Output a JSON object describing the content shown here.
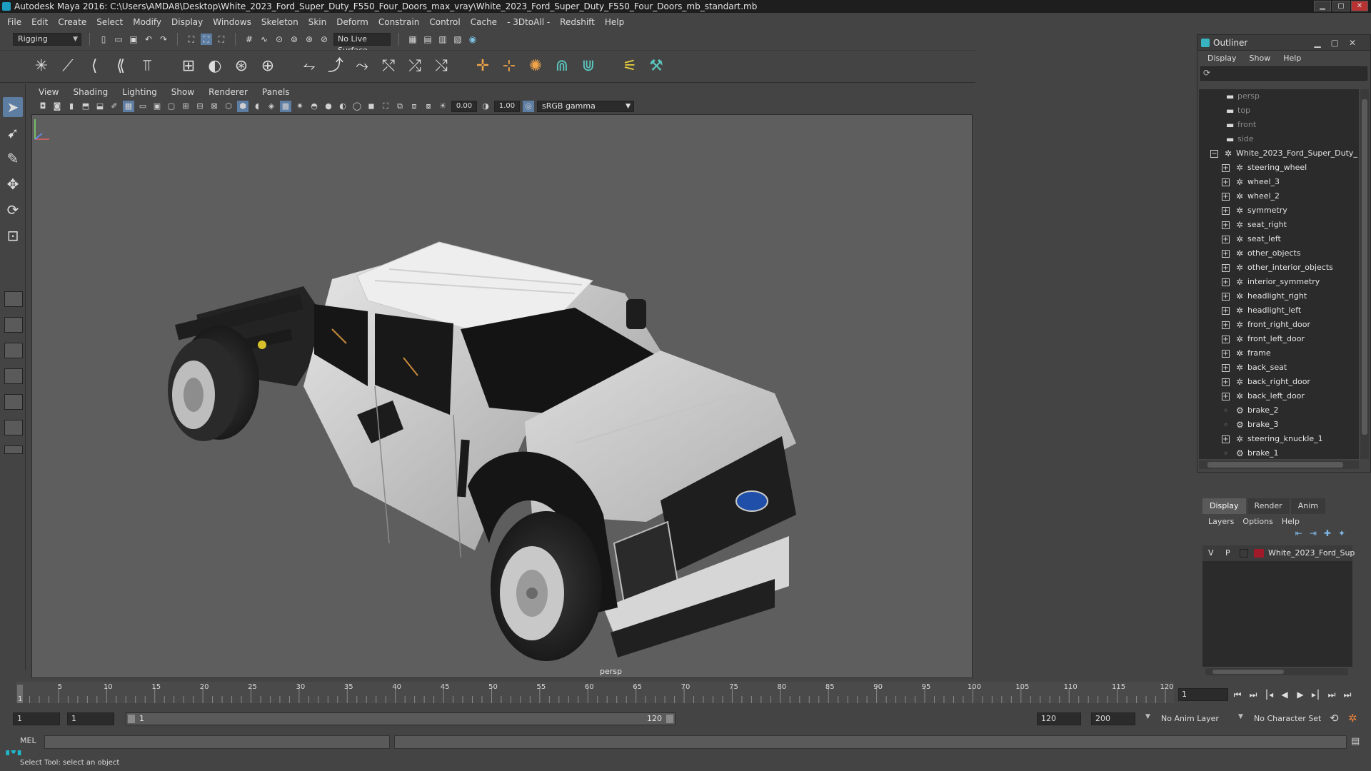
{
  "window": {
    "title": "Autodesk Maya 2016: C:\\Users\\AMDA8\\Desktop\\White_2023_Ford_Super_Duty_F550_Four_Doors_max_vray\\White_2023_Ford_Super_Duty_F550_Four_Doors_mb_standart.mb"
  },
  "menubar": [
    "File",
    "Edit",
    "Create",
    "Select",
    "Modify",
    "Display",
    "Windows",
    "Skeleton",
    "Skin",
    "Deform",
    "Constrain",
    "Control",
    "Cache",
    "- 3DtoAll -",
    "Redshift",
    "Help"
  ],
  "statusline": {
    "menu_set": "Rigging",
    "live_surface": "No Live Surface"
  },
  "panel": {
    "menus": [
      "View",
      "Shading",
      "Lighting",
      "Show",
      "Renderer",
      "Panels"
    ],
    "exposure": "0.00",
    "gamma": "1.00",
    "color_space": "sRGB gamma",
    "camera_label": "persp"
  },
  "outliner": {
    "title": "Outliner",
    "menus": [
      "Display",
      "Show",
      "Help"
    ],
    "items": [
      {
        "label": "persp",
        "type": "camera",
        "dim": true,
        "level": 1,
        "expander": ""
      },
      {
        "label": "top",
        "type": "camera",
        "dim": true,
        "level": 1,
        "expander": ""
      },
      {
        "label": "front",
        "type": "camera",
        "dim": true,
        "level": 1,
        "expander": ""
      },
      {
        "label": "side",
        "type": "camera",
        "dim": true,
        "level": 1,
        "expander": ""
      },
      {
        "label": "White_2023_Ford_Super_Duty_",
        "type": "group",
        "dim": false,
        "level": 0,
        "expander": "−"
      },
      {
        "label": "steering_wheel",
        "type": "group",
        "dim": false,
        "level": 1,
        "expander": "+"
      },
      {
        "label": "wheel_3",
        "type": "group",
        "dim": false,
        "level": 1,
        "expander": "+"
      },
      {
        "label": "wheel_2",
        "type": "group",
        "dim": false,
        "level": 1,
        "expander": "+"
      },
      {
        "label": "symmetry",
        "type": "group",
        "dim": false,
        "level": 1,
        "expander": "+"
      },
      {
        "label": "seat_right",
        "type": "group",
        "dim": false,
        "level": 1,
        "expander": "+"
      },
      {
        "label": "seat_left",
        "type": "group",
        "dim": false,
        "level": 1,
        "expander": "+"
      },
      {
        "label": "other_objects",
        "type": "group",
        "dim": false,
        "level": 1,
        "expander": "+"
      },
      {
        "label": "other_interior_objects",
        "type": "group",
        "dim": false,
        "level": 1,
        "expander": "+"
      },
      {
        "label": "interior_symmetry",
        "type": "group",
        "dim": false,
        "level": 1,
        "expander": "+"
      },
      {
        "label": "headlight_right",
        "type": "group",
        "dim": false,
        "level": 1,
        "expander": "+"
      },
      {
        "label": "headlight_left",
        "type": "group",
        "dim": false,
        "level": 1,
        "expander": "+"
      },
      {
        "label": "front_right_door",
        "type": "group",
        "dim": false,
        "level": 1,
        "expander": "+"
      },
      {
        "label": "front_left_door",
        "type": "group",
        "dim": false,
        "level": 1,
        "expander": "+"
      },
      {
        "label": "frame",
        "type": "group",
        "dim": false,
        "level": 1,
        "expander": "+"
      },
      {
        "label": "back_seat",
        "type": "group",
        "dim": false,
        "level": 1,
        "expander": "+"
      },
      {
        "label": "back_right_door",
        "type": "group",
        "dim": false,
        "level": 1,
        "expander": "+"
      },
      {
        "label": "back_left_door",
        "type": "group",
        "dim": false,
        "level": 1,
        "expander": "+"
      },
      {
        "label": "brake_2",
        "type": "mesh",
        "dim": false,
        "level": 1,
        "expander": ""
      },
      {
        "label": "brake_3",
        "type": "mesh",
        "dim": false,
        "level": 1,
        "expander": ""
      },
      {
        "label": "steering_knuckle_1",
        "type": "group",
        "dim": false,
        "level": 1,
        "expander": "+"
      },
      {
        "label": "brake_1",
        "type": "mesh",
        "dim": false,
        "level": 1,
        "expander": ""
      }
    ]
  },
  "layer_editor": {
    "tabs": [
      "Display",
      "Render",
      "Anim"
    ],
    "active_tab": "Display",
    "menus": [
      "Layers",
      "Options",
      "Help"
    ],
    "layers": [
      {
        "visible": "V",
        "playback": "P",
        "color": "#a01a2a",
        "name": "White_2023_Ford_Sup"
      }
    ]
  },
  "timeline": {
    "ticks": [
      5,
      10,
      15,
      20,
      25,
      30,
      35,
      40,
      45,
      50,
      55,
      60,
      65,
      70,
      75,
      80,
      85,
      90,
      95,
      100,
      105,
      110,
      115,
      120
    ],
    "start": 1,
    "end": 120,
    "current_frame": "1",
    "current_marker": "1"
  },
  "range": {
    "start_time": "1",
    "playback_start": "1",
    "range_start_label": "1",
    "range_end_label": "120",
    "playback_end": "120",
    "end_time": "200",
    "anim_layer": "No Anim Layer",
    "character_set": "No Character Set"
  },
  "cmdline": {
    "label": "MEL"
  },
  "helpline": {
    "text": "Select Tool: select an object"
  }
}
